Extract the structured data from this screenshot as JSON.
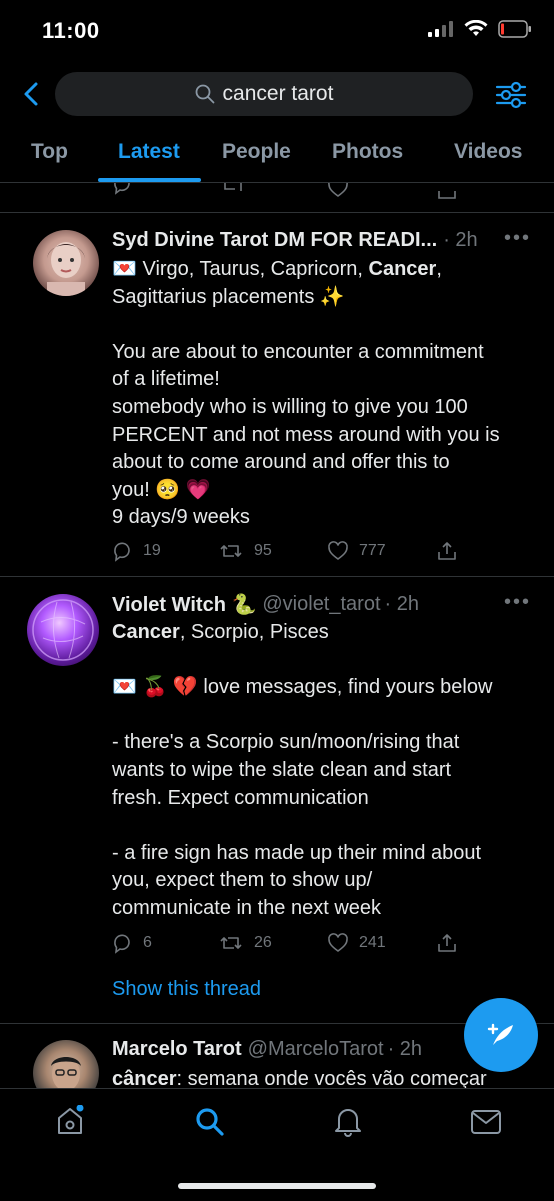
{
  "status": {
    "time": "11:00"
  },
  "search": {
    "query": "cancer tarot"
  },
  "tabs": [
    {
      "label": "Top"
    },
    {
      "label": "Latest"
    },
    {
      "label": "People"
    },
    {
      "label": "Photos"
    },
    {
      "label": "Videos"
    }
  ],
  "tweets": [
    {
      "name": "Syd Divine Tarot DM FOR READI...",
      "time": "· 2h",
      "line1_pre": "💌 Virgo, Taurus, Capricorn, ",
      "line1_bold": "Cancer",
      "line1_post": ",",
      "line2": "Sagittarius placements ✨",
      "para2_l1": "You are about to encounter a commitment",
      "para2_l2": "of a lifetime!",
      "para2_l3": "somebody who is willing to give you 100",
      "para2_l4": "PERCENT and not mess around with you is",
      "para2_l5": "about to come around and offer this to",
      "para2_l6": "you! 🥺 💗",
      "para2_l7": "9 days/9 weeks",
      "replies": "19",
      "retweets": "95",
      "likes": "777"
    },
    {
      "name": "Violet Witch 🐍",
      "handle": "@violet_tarot",
      "time": "· 2h",
      "line1_bold": "Cancer",
      "line1_post": ", Scorpio, Pisces",
      "line2": "💌 🍒 💔  love messages, find yours below",
      "p3_l1": "- there's a Scorpio sun/moon/rising that",
      "p3_l2": "wants to wipe the slate clean and start",
      "p3_l3": "fresh. Expect communication",
      "p4_l1": "- a fire sign has made up their mind about",
      "p4_l2": "you, expect them to show up/",
      "p4_l3": "communicate in the next week",
      "replies": "6",
      "retweets": "26",
      "likes": "241",
      "thread_link": "Show this thread"
    },
    {
      "name": "Marcelo Tarot",
      "handle": "@MarceloTarot",
      "time": "· 2h",
      "line1_bold": "câncer",
      "line1_post": ": semana onde vocês vão começar"
    }
  ],
  "colors": {
    "accent": "#1d9bf0",
    "muted": "#71767b",
    "text": "#e7e9ea",
    "border": "#2f3336"
  },
  "nav": [
    "home-icon",
    "search-icon",
    "notifications-icon",
    "messages-icon"
  ]
}
